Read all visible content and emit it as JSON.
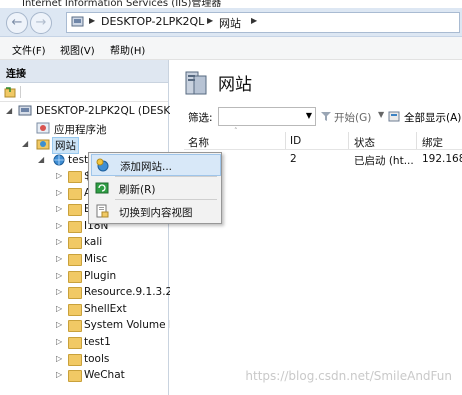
{
  "window": {
    "title": "Internet Information Services (IIS)管理器"
  },
  "address": {
    "crumbs": [
      "DESKTOP-2LPK2QL",
      "网站"
    ],
    "sep": "▶"
  },
  "menu": {
    "file": "文件(F)",
    "view": "视图(V)",
    "help": "帮助(H)"
  },
  "left_pane": {
    "header": "连接",
    "tree": {
      "server": "DESKTOP-2LPK2QL (DESK",
      "app_pools": "应用程序池",
      "sites": "网站",
      "site_test": "test",
      "folders": [
        "$",
        "A",
        "E",
        "I18N",
        "kali",
        "Misc",
        "Plugin",
        "Resource.9.1.3.25",
        "ShellExt",
        "System Volume I",
        "test1",
        "tools",
        "WeChat"
      ]
    }
  },
  "context_menu": {
    "items": [
      {
        "label": "添加网站...",
        "icon": "add-site-icon",
        "highlighted": true
      },
      {
        "label": "刷新(R)",
        "icon": "refresh-icon",
        "highlighted": false
      },
      {
        "label": "切换到内容视图",
        "icon": "content-view-icon",
        "highlighted": false
      }
    ]
  },
  "right_pane": {
    "title": "网站",
    "filter_label": "筛选:",
    "start_label": "开始(G)",
    "show_all_label": "全部显示(A)",
    "columns": [
      "名称",
      "ID",
      "状态",
      "绑定"
    ],
    "rows": [
      {
        "name": "",
        "id": "2",
        "status": "已启动 (ht...",
        "binding": "192.168.2"
      }
    ]
  },
  "watermark": "https://blog.csdn.net/SmileAndFun"
}
